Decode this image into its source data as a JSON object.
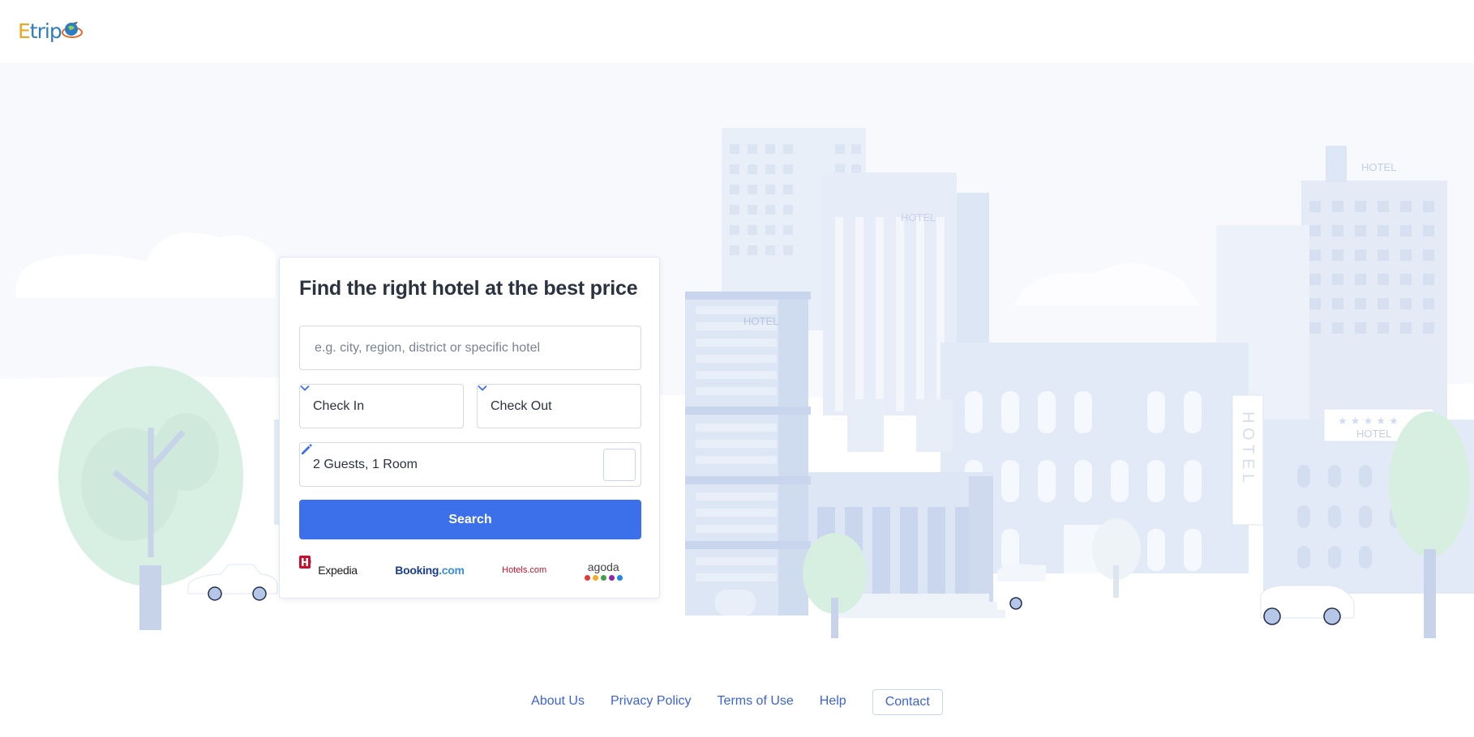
{
  "brand": {
    "logo_e": "E",
    "logo_rest": "trip"
  },
  "search": {
    "title": "Find the right hotel at the best price",
    "destination_placeholder": "e.g. city, region, district or specific hotel",
    "destination_value": "",
    "check_in_label": "Check In",
    "check_out_label": "Check Out",
    "guests_label": "2 Guests, 1 Room",
    "search_button": "Search"
  },
  "partners": {
    "expedia": "Expedia",
    "booking_name": "Booking",
    "booking_tld": ".com",
    "hotels": "Hotels.com",
    "agoda": "agoda",
    "agoda_dot_colors": [
      "#e53935",
      "#f9a825",
      "#43a047",
      "#8e24aa",
      "#1e88e5"
    ]
  },
  "illustration": {
    "signs": [
      "HOTEL",
      "HOTEL",
      "HOTEL",
      "HOTEL",
      "H O T E L"
    ],
    "stars": "★ ★ ★ ★ ★"
  },
  "footer": {
    "about": "About Us",
    "privacy": "Privacy Policy",
    "terms": "Terms of Use",
    "help": "Help",
    "contact": "Contact"
  },
  "colors": {
    "accent": "#3c70ea",
    "link": "#3c63d6",
    "hero_bg": "#f7f9fd"
  }
}
